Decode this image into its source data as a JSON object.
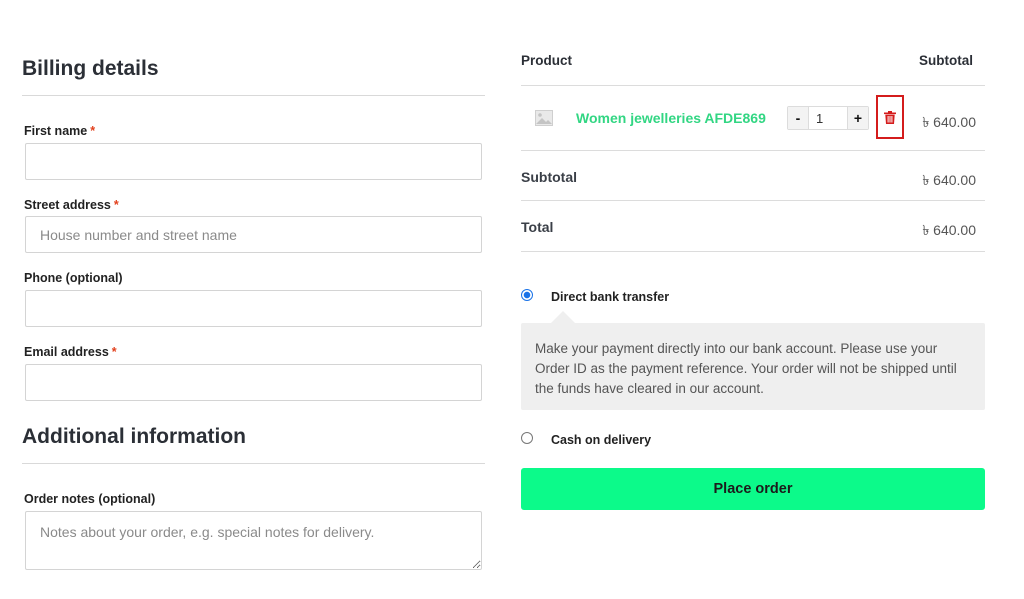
{
  "billing": {
    "title": "Billing details",
    "fields": {
      "first_name": {
        "label": "First name",
        "required_mark": "*",
        "value": "",
        "placeholder": ""
      },
      "street_address": {
        "label": "Street address",
        "required_mark": "*",
        "value": "",
        "placeholder": "House number and street name"
      },
      "phone": {
        "label": "Phone (optional)",
        "value": "",
        "placeholder": ""
      },
      "email": {
        "label": "Email address",
        "required_mark": "*",
        "value": "",
        "placeholder": ""
      }
    }
  },
  "additional": {
    "title": "Additional information",
    "order_notes": {
      "label": "Order notes (optional)",
      "value": "",
      "placeholder": "Notes about your order, e.g. special notes for delivery."
    }
  },
  "order": {
    "headers": {
      "product": "Product",
      "subtotal": "Subtotal"
    },
    "item": {
      "name": "Women jewelleries AFDE869",
      "quantity": "1",
      "decrement_label": "-",
      "increment_label": "+",
      "price": "৳ 640.00",
      "thumbnail_icon": "image-placeholder-icon",
      "delete_icon": "trash-icon"
    },
    "subtotal": {
      "label": "Subtotal",
      "value": "৳ 640.00"
    },
    "total": {
      "label": "Total",
      "value": "৳ 640.00"
    }
  },
  "payment": {
    "selected": "bank_transfer",
    "bank_transfer": {
      "label": "Direct bank transfer",
      "description": "Make your payment directly into our bank account. Please use your Order ID as the payment reference. Your order will not be shipped until the funds have cleared in our account."
    },
    "cod": {
      "label": "Cash on delivery"
    }
  },
  "place_order_label": "Place order",
  "colors": {
    "product_link": "#32d683",
    "place_order_bg": "#0cfa8a",
    "delete_highlight": "#d41c1c",
    "required_mark": "#e2401c",
    "radio_selected": "#1a73e8"
  }
}
